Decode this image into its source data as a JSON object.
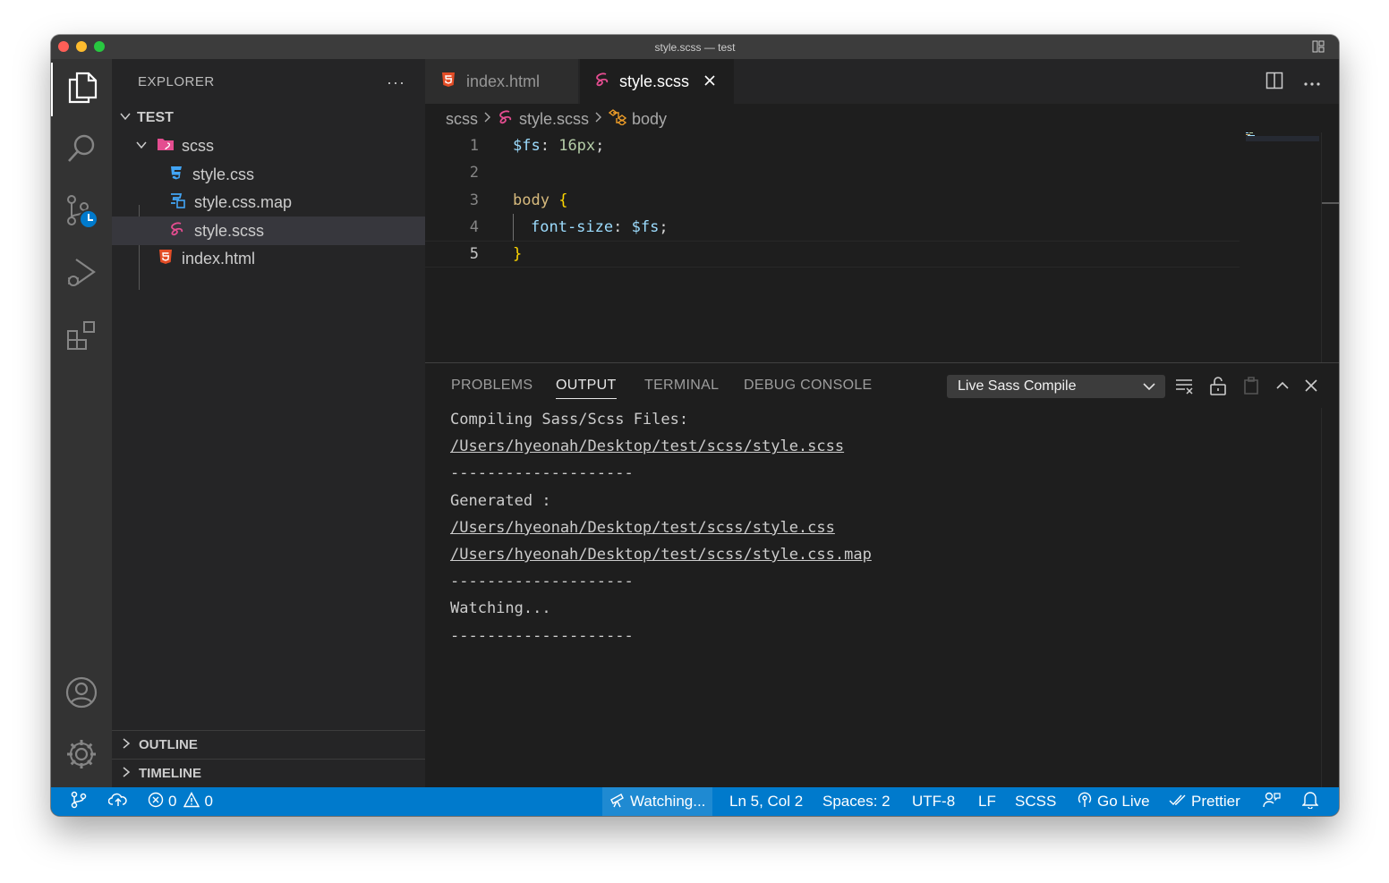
{
  "window": {
    "title": "style.scss — test"
  },
  "explorer": {
    "title": "EXPLORER",
    "more": "···",
    "root": "TEST",
    "folder": "scss",
    "files": [
      "style.css",
      "style.css.map",
      "style.scss",
      "index.html"
    ],
    "sections": [
      "OUTLINE",
      "TIMELINE"
    ]
  },
  "tabs": [
    {
      "label": "index.html",
      "icon": "html5-icon"
    },
    {
      "label": "style.scss",
      "icon": "sass-icon"
    }
  ],
  "breadcrumb": [
    "scss",
    "style.scss",
    "body"
  ],
  "editor": {
    "line_numbers": [
      "1",
      "2",
      "3",
      "4",
      "5"
    ],
    "current_line": 5,
    "code": {
      "l1_var": "$fs",
      "l1_colon": ": ",
      "l1_val": "16px",
      "l1_semi": ";",
      "l3_sel": "body",
      "l3_brace": "{",
      "l4_prop": "font-size",
      "l4_colon": ": ",
      "l4_val": "$fs",
      "l4_semi": ";",
      "l5_brace": "}"
    }
  },
  "panel": {
    "tabs": [
      "PROBLEMS",
      "OUTPUT",
      "TERMINAL",
      "DEBUG CONSOLE"
    ],
    "active_tab": "OUTPUT",
    "channel": "Live Sass Compile",
    "output": [
      "Compiling Sass/Scss Files:",
      "/Users/hyeonah/Desktop/test/scss/style.scss",
      "--------------------",
      "Generated :",
      "/Users/hyeonah/Desktop/test/scss/style.css",
      "/Users/hyeonah/Desktop/test/scss/style.css.map",
      "--------------------",
      "Watching...",
      "--------------------"
    ]
  },
  "status": {
    "errors": "0",
    "warnings": "0",
    "watching": "Watching...",
    "position": "Ln 5, Col 2",
    "spaces": "Spaces: 2",
    "encoding": "UTF-8",
    "eol": "LF",
    "language": "SCSS",
    "golive": "Go Live",
    "prettier": "Prettier"
  },
  "colors": {
    "statusbar": "#007acc",
    "sass": "#e44d90",
    "html": "#e44d26",
    "css": "#42a5f5"
  }
}
